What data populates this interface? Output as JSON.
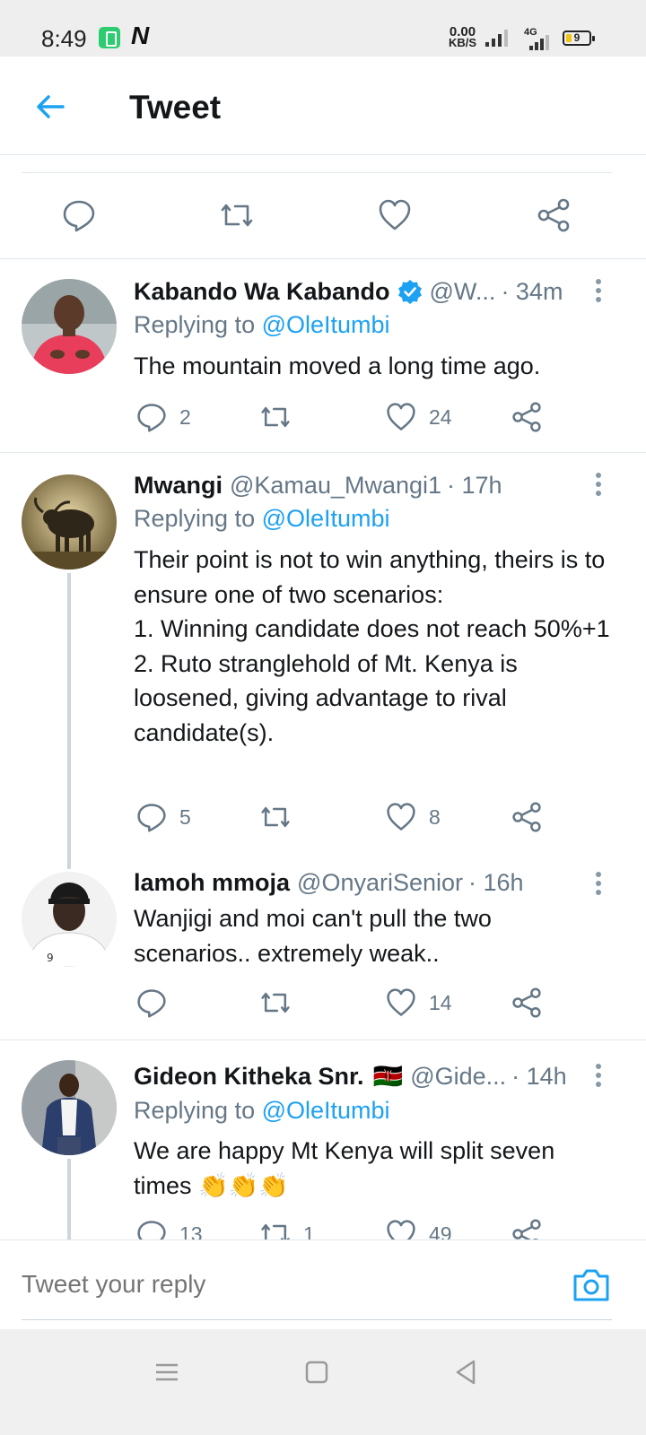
{
  "status_bar": {
    "time": "8:49",
    "app_icon_2": "N",
    "speed_value": "0.00",
    "speed_unit": "KB/S",
    "network": "4G",
    "battery_level": "9"
  },
  "header": {
    "title": "Tweet",
    "back_icon": "arrow-left-icon"
  },
  "main_actions": [
    "reply-icon",
    "retweet-icon",
    "like-icon",
    "share-icon"
  ],
  "tweets": [
    {
      "name": "Kabando Wa Kabando",
      "verified": true,
      "handle": "@W...",
      "time": "· 34m",
      "replying_prefix": "Replying to ",
      "replying_to": "@OleItumbi",
      "body": "The mountain moved a long time ago.",
      "replies": "2",
      "retweets": "",
      "likes": "24"
    },
    {
      "name": "Mwangi",
      "verified": false,
      "handle": "@Kamau_Mwangi1",
      "time": "· 17h",
      "replying_prefix": "Replying to ",
      "replying_to": "@OleItumbi",
      "body": "Their point is not to win anything, theirs is to ensure one of two scenarios:\n1. Winning candidate does not reach 50%+1\n2. Ruto stranglehold of Mt. Kenya is loosened, giving advantage to rival candidate(s).",
      "replies": "5",
      "retweets": "",
      "likes": "8"
    },
    {
      "name": "lamoh mmoja",
      "verified": false,
      "handle": "@OnyariSenior",
      "time": "· 16h",
      "replying_prefix": "",
      "replying_to": "",
      "body": "Wanjigi and moi can't pull the two scenarios.. extremely weak..",
      "replies": "",
      "retweets": "",
      "likes": "14"
    },
    {
      "name": "Gideon Kitheka Snr.",
      "flag": "🇰🇪",
      "verified": false,
      "handle": "@Gide...",
      "time": "· 14h",
      "replying_prefix": "Replying to ",
      "replying_to": "@OleItumbi",
      "body": "We are happy Mt Kenya will split seven times 👏👏👏",
      "replies": "13",
      "retweets": "1",
      "likes": "49"
    }
  ],
  "composer": {
    "placeholder": "Tweet your reply",
    "camera_icon": "camera-icon"
  },
  "colors": {
    "accent": "#1da1f2",
    "text": "#14171a",
    "muted": "#657786",
    "divider": "#e1e8ed"
  }
}
